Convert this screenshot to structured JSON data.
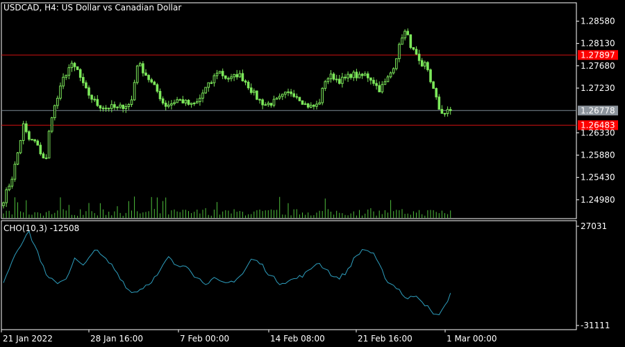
{
  "header": {
    "symbol_title": "USDCAD, H4:  US Dollar vs Canadian Dollar"
  },
  "colors": {
    "background": "#000000",
    "frame": "#ffffff",
    "candle": "#7ce85a",
    "volume": "#4fbf3c",
    "level_line": "#d01010",
    "level_label_bg": "#ff0000",
    "price_line": "#7d8b96",
    "price_label_bg": "#8c949c",
    "indicator": "#2e9fbf"
  },
  "chart_data": [
    {
      "type": "candlestick",
      "title": "USDCAD, H4:  US Dollar vs Canadian Dollar",
      "ylim": [
        1.246,
        1.2895
      ],
      "y_ticks": [
        "1.28580",
        "1.28130",
        "1.27680",
        "1.27230",
        "1.26330",
        "1.25880",
        "1.25430",
        "1.24980"
      ],
      "x_ticks": [
        "21 Jan 2022",
        "28 Jan 16:00",
        "7 Feb 00:00",
        "14 Feb 08:00",
        "21 Feb 16:00",
        "1 Mar 00:00"
      ],
      "last_price": "1.26778",
      "levels": [
        {
          "label": "1.27897",
          "value": 1.27897
        },
        {
          "label": "1.26483",
          "value": 1.26483
        }
      ],
      "grid": false
    },
    {
      "type": "line",
      "title": "CHO(10,3) -12508",
      "ylim": [
        -31111,
        27031
      ],
      "y_ticks": [
        "27031",
        "-31111"
      ]
    }
  ]
}
